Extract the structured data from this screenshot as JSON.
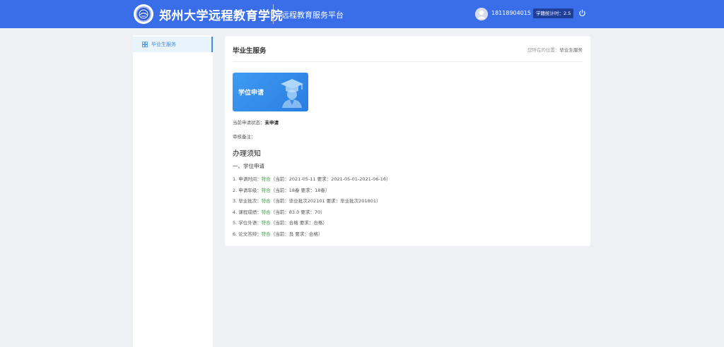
{
  "header": {
    "site_title": "郑州大学远程教育学院",
    "platform": "远程教育服务平台",
    "user_id": "18118904015",
    "credit_badge": "学籍统计时：2.5"
  },
  "sidebar": {
    "items": [
      {
        "label": "毕业生服务",
        "icon": "grid-icon",
        "active": true
      }
    ]
  },
  "main": {
    "title": "毕业生服务",
    "breadcrumb_prefix": "您所在的位置：",
    "breadcrumb_current": "毕业生服务",
    "card_label": "学位申请",
    "status_label": "当前申请状态：",
    "status_value": "未申请",
    "remark_label": "审核备注：",
    "notice_title": "办理须知",
    "notice_sub": "一、学位申请",
    "requirements": [
      {
        "label": "1. 申请时间：",
        "result": "符合",
        "detail": "（当前：2021-05-11 要求：2021-05-01-2021-06-16）"
      },
      {
        "label": "2. 申请年级：",
        "result": "符合",
        "detail": "（当前：18春 要求：18春）"
      },
      {
        "label": "3. 毕业批次：",
        "result": "符合",
        "detail": "（当前：毕业批次202101 要求：毕业批次201801）"
      },
      {
        "label": "4. 课程成绩：",
        "result": "符合",
        "detail": "（当前：83.0 要求：70）"
      },
      {
        "label": "5. 学位外语：",
        "result": "符合",
        "detail": "（当前：合格 要求：合格）"
      },
      {
        "label": "6. 论文答辩：",
        "result": "符合",
        "detail": "（当前：良 要求：合格）"
      }
    ]
  },
  "colors": {
    "header_bg": "#3a6ee8",
    "accent": "#3a8ee6",
    "ok": "#2e9e3e"
  }
}
